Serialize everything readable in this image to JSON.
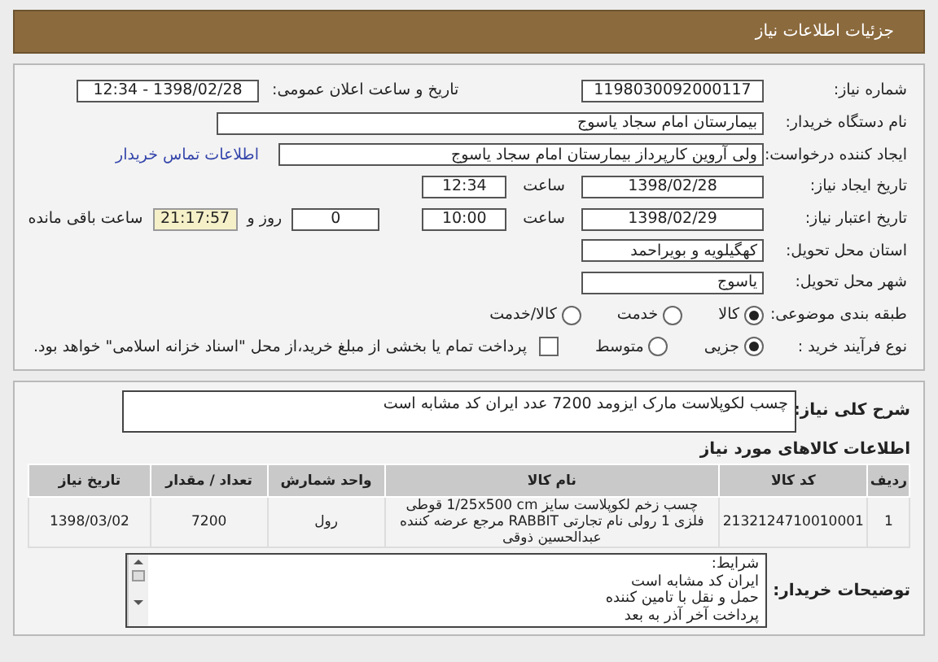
{
  "header": {
    "title": "جزئیات اطلاعات نیاز"
  },
  "need_number": {
    "label": "شماره نیاز:",
    "value": "1198030092000117"
  },
  "announce": {
    "label": "تاریخ و ساعت اعلان عمومی:",
    "value": "1398/02/28 - 12:34"
  },
  "buyer_org": {
    "label": "نام دستگاه خریدار:",
    "value": "بیمارستان امام سجاد یاسوج"
  },
  "requester": {
    "label": "ایجاد کننده درخواست:",
    "value": "ولی آروین کارپرداز بیمارستان امام سجاد یاسوج",
    "contact_link": "اطلاعات تماس خریدار"
  },
  "created": {
    "label": "تاریخ ایجاد نیاز:",
    "date": "1398/02/28",
    "time_label": "ساعت",
    "time": "12:34"
  },
  "validity": {
    "label": "تاریخ اعتبار نیاز:",
    "date": "1398/02/29",
    "time_label": "ساعت",
    "time": "10:00",
    "days": "0",
    "days_label": "روز و",
    "remaining": "21:17:57",
    "remaining_label": "ساعت باقی مانده"
  },
  "province": {
    "label": "استان محل تحویل:",
    "value": "کهگیلویه و بویراحمد"
  },
  "city": {
    "label": "شهر محل تحویل:",
    "value": "یاسوج"
  },
  "category": {
    "label": "طبقه بندی موضوعی:",
    "options": [
      {
        "label": "کالا",
        "selected": true
      },
      {
        "label": "خدمت",
        "selected": false
      },
      {
        "label": "کالا/خدمت",
        "selected": false
      }
    ]
  },
  "purchase_process": {
    "label": "نوع فرآیند خرید :",
    "options": [
      {
        "label": "جزیی",
        "selected": true
      },
      {
        "label": "متوسط",
        "selected": false
      }
    ],
    "treasury": {
      "checked": false,
      "text": "پرداخت تمام یا بخشی از مبلغ خرید،از محل \"اسناد خزانه اسلامی\" خواهد بود."
    }
  },
  "summary": {
    "label": "شرح کلی نیاز:",
    "value": "چسب لکوپلاست مارک ایزومد 7200 عدد ایران کد مشابه است"
  },
  "items_title": "اطلاعات کالاهای مورد نیاز",
  "table": {
    "columns": [
      "ردیف",
      "کد کالا",
      "نام کالا",
      "واحد شمارش",
      "تعداد / مقدار",
      "تاریخ نیاز"
    ],
    "rows": [
      [
        "1",
        "2132124710010001",
        "چسب زخم لکوپلاست سایز 1/25x500 cm قوطی فلزی 1 رولی نام تجارتی RABBIT مرجع عرضه کننده عبدالحسین ذوقی",
        "رول",
        "7200",
        "1398/03/02"
      ]
    ]
  },
  "buyer_notes": {
    "label": "توضیحات خریدار:",
    "lines": [
      "شرایط:",
      "ایران کد مشابه است",
      "حمل و نقل با تامین کننده",
      "پرداخت آخر آذر به بعد"
    ]
  }
}
